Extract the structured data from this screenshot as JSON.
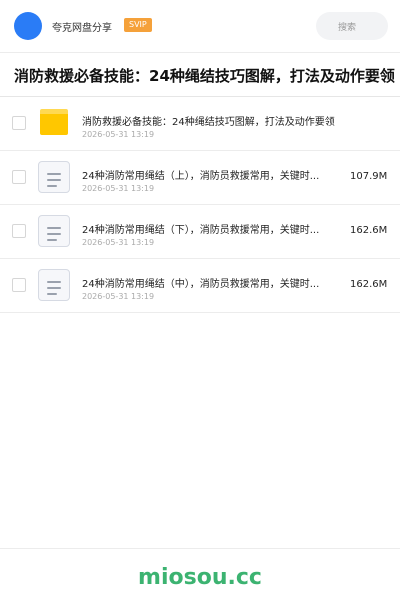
{
  "header": {
    "site_name": "夸克网盘分享",
    "badge": "SVIP",
    "search_placeholder": "搜索"
  },
  "page": {
    "title": "消防救援必备技能：24种绳结技巧图解，打法及动作要领"
  },
  "files": [
    {
      "type": "folder",
      "name": "消防救援必备技能：24种绳结技巧图解，打法及动作要领",
      "date": "2026-05-31 13:19",
      "size": ""
    },
    {
      "type": "doc",
      "name": "24种消防常用绳结（上），消防员救援常用，关键时...",
      "date": "2026-05-31 13:19",
      "size": "107.9M"
    },
    {
      "type": "doc",
      "name": "24种消防常用绳结（下），消防员救援常用，关键时...",
      "date": "2026-05-31 13:19",
      "size": "162.6M"
    },
    {
      "type": "doc",
      "name": "24种消防常用绳结（中），消防员救援常用，关键时...",
      "date": "2026-05-31 13:19",
      "size": "162.6M"
    }
  ],
  "footer": {
    "logo_text": "miosou.cc"
  },
  "colors": {
    "avatar": "#2a7cf6",
    "badge": "#f5a13a",
    "folder": "#ffc700",
    "logo": "#3cb371"
  },
  "icons": {
    "folder": "folder-icon",
    "doc": "document-icon"
  }
}
